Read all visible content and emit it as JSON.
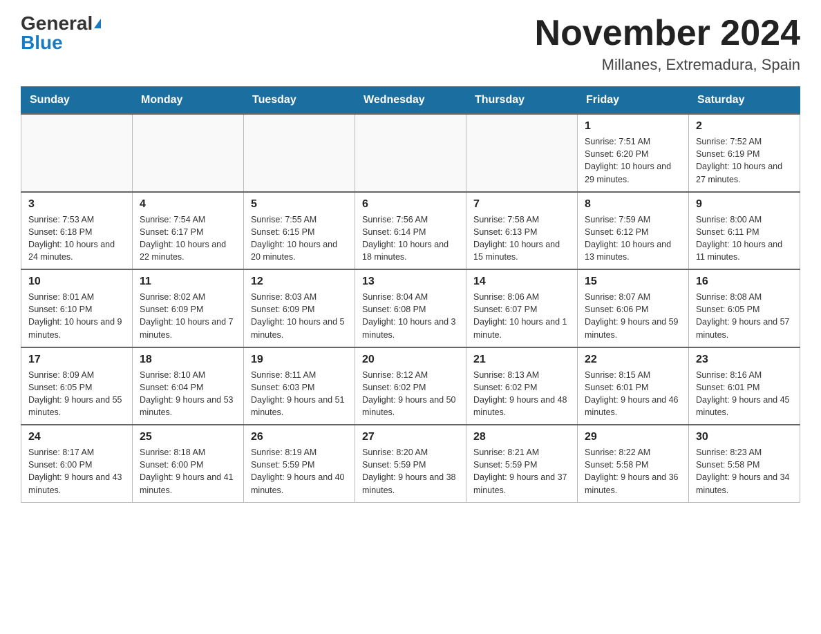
{
  "header": {
    "logo_general": "General",
    "logo_blue": "Blue",
    "month_title": "November 2024",
    "location": "Millanes, Extremadura, Spain"
  },
  "days_of_week": [
    "Sunday",
    "Monday",
    "Tuesday",
    "Wednesday",
    "Thursday",
    "Friday",
    "Saturday"
  ],
  "weeks": [
    {
      "days": [
        {
          "number": "",
          "info": ""
        },
        {
          "number": "",
          "info": ""
        },
        {
          "number": "",
          "info": ""
        },
        {
          "number": "",
          "info": ""
        },
        {
          "number": "",
          "info": ""
        },
        {
          "number": "1",
          "info": "Sunrise: 7:51 AM\nSunset: 6:20 PM\nDaylight: 10 hours and 29 minutes."
        },
        {
          "number": "2",
          "info": "Sunrise: 7:52 AM\nSunset: 6:19 PM\nDaylight: 10 hours and 27 minutes."
        }
      ]
    },
    {
      "days": [
        {
          "number": "3",
          "info": "Sunrise: 7:53 AM\nSunset: 6:18 PM\nDaylight: 10 hours and 24 minutes."
        },
        {
          "number": "4",
          "info": "Sunrise: 7:54 AM\nSunset: 6:17 PM\nDaylight: 10 hours and 22 minutes."
        },
        {
          "number": "5",
          "info": "Sunrise: 7:55 AM\nSunset: 6:15 PM\nDaylight: 10 hours and 20 minutes."
        },
        {
          "number": "6",
          "info": "Sunrise: 7:56 AM\nSunset: 6:14 PM\nDaylight: 10 hours and 18 minutes."
        },
        {
          "number": "7",
          "info": "Sunrise: 7:58 AM\nSunset: 6:13 PM\nDaylight: 10 hours and 15 minutes."
        },
        {
          "number": "8",
          "info": "Sunrise: 7:59 AM\nSunset: 6:12 PM\nDaylight: 10 hours and 13 minutes."
        },
        {
          "number": "9",
          "info": "Sunrise: 8:00 AM\nSunset: 6:11 PM\nDaylight: 10 hours and 11 minutes."
        }
      ]
    },
    {
      "days": [
        {
          "number": "10",
          "info": "Sunrise: 8:01 AM\nSunset: 6:10 PM\nDaylight: 10 hours and 9 minutes."
        },
        {
          "number": "11",
          "info": "Sunrise: 8:02 AM\nSunset: 6:09 PM\nDaylight: 10 hours and 7 minutes."
        },
        {
          "number": "12",
          "info": "Sunrise: 8:03 AM\nSunset: 6:09 PM\nDaylight: 10 hours and 5 minutes."
        },
        {
          "number": "13",
          "info": "Sunrise: 8:04 AM\nSunset: 6:08 PM\nDaylight: 10 hours and 3 minutes."
        },
        {
          "number": "14",
          "info": "Sunrise: 8:06 AM\nSunset: 6:07 PM\nDaylight: 10 hours and 1 minute."
        },
        {
          "number": "15",
          "info": "Sunrise: 8:07 AM\nSunset: 6:06 PM\nDaylight: 9 hours and 59 minutes."
        },
        {
          "number": "16",
          "info": "Sunrise: 8:08 AM\nSunset: 6:05 PM\nDaylight: 9 hours and 57 minutes."
        }
      ]
    },
    {
      "days": [
        {
          "number": "17",
          "info": "Sunrise: 8:09 AM\nSunset: 6:05 PM\nDaylight: 9 hours and 55 minutes."
        },
        {
          "number": "18",
          "info": "Sunrise: 8:10 AM\nSunset: 6:04 PM\nDaylight: 9 hours and 53 minutes."
        },
        {
          "number": "19",
          "info": "Sunrise: 8:11 AM\nSunset: 6:03 PM\nDaylight: 9 hours and 51 minutes."
        },
        {
          "number": "20",
          "info": "Sunrise: 8:12 AM\nSunset: 6:02 PM\nDaylight: 9 hours and 50 minutes."
        },
        {
          "number": "21",
          "info": "Sunrise: 8:13 AM\nSunset: 6:02 PM\nDaylight: 9 hours and 48 minutes."
        },
        {
          "number": "22",
          "info": "Sunrise: 8:15 AM\nSunset: 6:01 PM\nDaylight: 9 hours and 46 minutes."
        },
        {
          "number": "23",
          "info": "Sunrise: 8:16 AM\nSunset: 6:01 PM\nDaylight: 9 hours and 45 minutes."
        }
      ]
    },
    {
      "days": [
        {
          "number": "24",
          "info": "Sunrise: 8:17 AM\nSunset: 6:00 PM\nDaylight: 9 hours and 43 minutes."
        },
        {
          "number": "25",
          "info": "Sunrise: 8:18 AM\nSunset: 6:00 PM\nDaylight: 9 hours and 41 minutes."
        },
        {
          "number": "26",
          "info": "Sunrise: 8:19 AM\nSunset: 5:59 PM\nDaylight: 9 hours and 40 minutes."
        },
        {
          "number": "27",
          "info": "Sunrise: 8:20 AM\nSunset: 5:59 PM\nDaylight: 9 hours and 38 minutes."
        },
        {
          "number": "28",
          "info": "Sunrise: 8:21 AM\nSunset: 5:59 PM\nDaylight: 9 hours and 37 minutes."
        },
        {
          "number": "29",
          "info": "Sunrise: 8:22 AM\nSunset: 5:58 PM\nDaylight: 9 hours and 36 minutes."
        },
        {
          "number": "30",
          "info": "Sunrise: 8:23 AM\nSunset: 5:58 PM\nDaylight: 9 hours and 34 minutes."
        }
      ]
    }
  ]
}
